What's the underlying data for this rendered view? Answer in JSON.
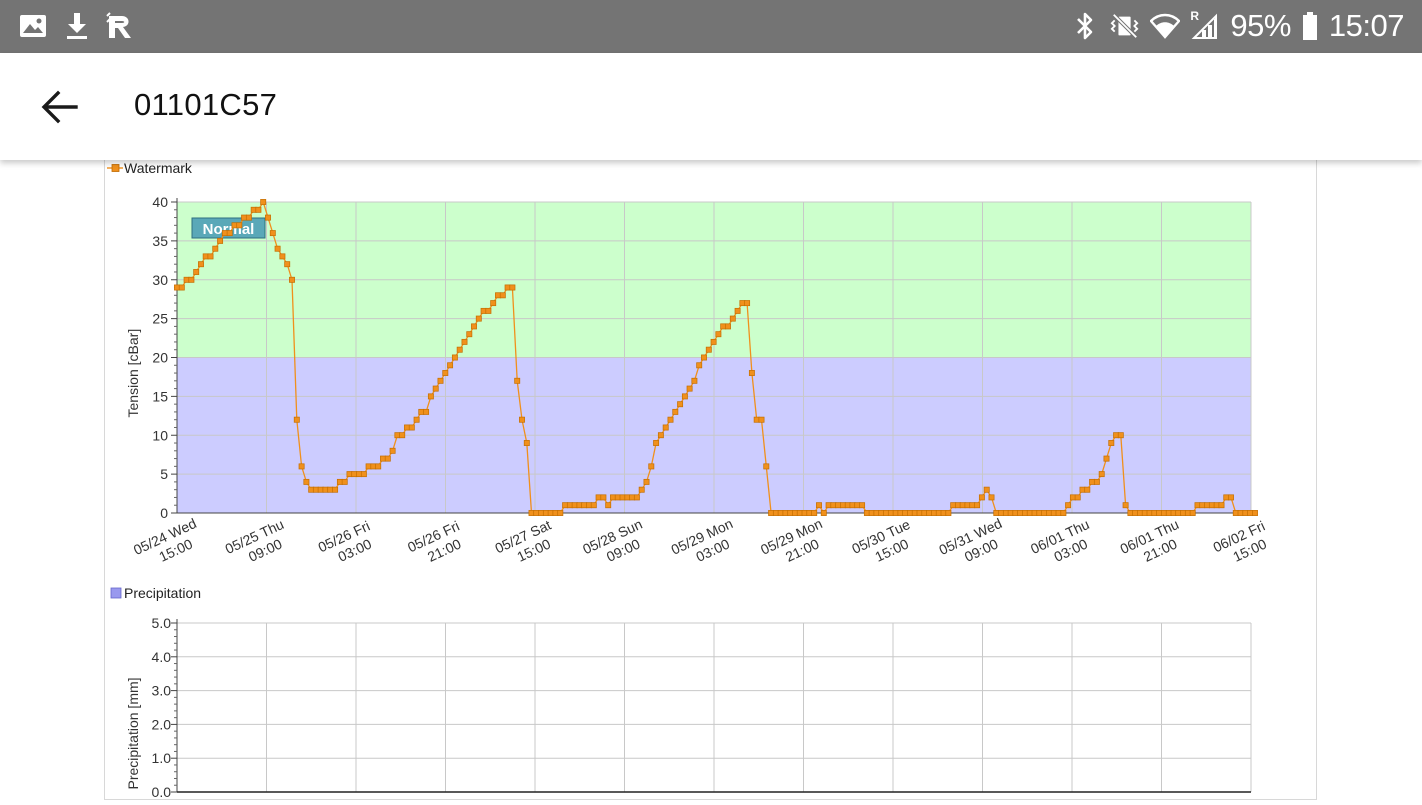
{
  "status_bar": {
    "left_icons": [
      "image-icon",
      "download-icon",
      "app-r-icon"
    ],
    "right_icons": [
      "bluetooth-icon",
      "vibrate-icon",
      "wifi-icon",
      "signal-icon"
    ],
    "signal_badge": "R",
    "battery_percent": "95%",
    "time": "15:07",
    "battery_level": 0.95
  },
  "toolbar": {
    "back_icon": "arrow-back-icon",
    "title": "01101C57"
  },
  "chart_data": [
    {
      "type": "line",
      "title": "",
      "legend": [
        "Watermark"
      ],
      "legend_placement": "top-left",
      "xlabel": "",
      "ylabel": "Tension [cBar]",
      "ylim": [
        0,
        40
      ],
      "y_ticks": [
        0,
        5,
        10,
        15,
        20,
        25,
        30,
        35,
        40
      ],
      "x_unit_hours_start": "05/24 Wed 15:00",
      "x_ticks": [
        {
          "h": 0,
          "l1": "05/24 Wed",
          "l2": "15:00"
        },
        {
          "h": 18,
          "l1": "05/25 Thu",
          "l2": "09:00"
        },
        {
          "h": 36,
          "l1": "05/26 Fri",
          "l2": "03:00"
        },
        {
          "h": 54,
          "l1": "05/26 Fri",
          "l2": "21:00"
        },
        {
          "h": 72,
          "l1": "05/27 Sat",
          "l2": "15:00"
        },
        {
          "h": 90,
          "l1": "05/28 Sun",
          "l2": "09:00"
        },
        {
          "h": 108,
          "l1": "05/29 Mon",
          "l2": "03:00"
        },
        {
          "h": 126,
          "l1": "05/29 Mon",
          "l2": "21:00"
        },
        {
          "h": 144,
          "l1": "05/30 Tue",
          "l2": "15:00"
        },
        {
          "h": 162,
          "l1": "05/31 Wed",
          "l2": "09:00"
        },
        {
          "h": 180,
          "l1": "06/01 Thu",
          "l2": "03:00"
        },
        {
          "h": 198,
          "l1": "06/01 Thu",
          "l2": "21:00"
        },
        {
          "h": 216,
          "l1": "06/02 Fri",
          "l2": "15:00"
        }
      ],
      "xlim_hours": [
        0,
        216
      ],
      "grid": true,
      "bands": [
        {
          "label": "Normal",
          "from": 20,
          "to": 40,
          "color": "#ccffcc"
        },
        {
          "label": "",
          "from": 0,
          "to": 20,
          "color": "#ccccff"
        }
      ],
      "series": [
        {
          "name": "Watermark",
          "color": "#f0901c",
          "points": [
            [
              0,
              29
            ],
            [
              1,
              29
            ],
            [
              2,
              30
            ],
            [
              3,
              30
            ],
            [
              4,
              31
            ],
            [
              5,
              32
            ],
            [
              6,
              33
            ],
            [
              7,
              33
            ],
            [
              8,
              34
            ],
            [
              9,
              35
            ],
            [
              10,
              36
            ],
            [
              11,
              36
            ],
            [
              12,
              37
            ],
            [
              13,
              37
            ],
            [
              14,
              38
            ],
            [
              15,
              38
            ],
            [
              16,
              39
            ],
            [
              17,
              39
            ],
            [
              18,
              40
            ],
            [
              19,
              38
            ],
            [
              20,
              36
            ],
            [
              21,
              34
            ],
            [
              22,
              33
            ],
            [
              23,
              32
            ],
            [
              24,
              30
            ],
            [
              25,
              12
            ],
            [
              26,
              6
            ],
            [
              27,
              4
            ],
            [
              28,
              3
            ],
            [
              29,
              3
            ],
            [
              30,
              3
            ],
            [
              31,
              3
            ],
            [
              32,
              3
            ],
            [
              33,
              3
            ],
            [
              34,
              4
            ],
            [
              35,
              4
            ],
            [
              36,
              5
            ],
            [
              37,
              5
            ],
            [
              38,
              5
            ],
            [
              39,
              5
            ],
            [
              40,
              6
            ],
            [
              41,
              6
            ],
            [
              42,
              6
            ],
            [
              43,
              7
            ],
            [
              44,
              7
            ],
            [
              45,
              8
            ],
            [
              46,
              10
            ],
            [
              47,
              10
            ],
            [
              48,
              11
            ],
            [
              49,
              11
            ],
            [
              50,
              12
            ],
            [
              51,
              13
            ],
            [
              52,
              13
            ],
            [
              53,
              15
            ],
            [
              54,
              16
            ],
            [
              55,
              17
            ],
            [
              56,
              18
            ],
            [
              57,
              19
            ],
            [
              58,
              20
            ],
            [
              59,
              21
            ],
            [
              60,
              22
            ],
            [
              61,
              23
            ],
            [
              62,
              24
            ],
            [
              63,
              25
            ],
            [
              64,
              26
            ],
            [
              65,
              26
            ],
            [
              66,
              27
            ],
            [
              67,
              28
            ],
            [
              68,
              28
            ],
            [
              69,
              29
            ],
            [
              70,
              29
            ],
            [
              71,
              17
            ],
            [
              72,
              12
            ],
            [
              73,
              9
            ],
            [
              74,
              0
            ],
            [
              75,
              0
            ],
            [
              76,
              0
            ],
            [
              77,
              0
            ],
            [
              78,
              0
            ],
            [
              79,
              0
            ],
            [
              80,
              0
            ],
            [
              81,
              1
            ],
            [
              82,
              1
            ],
            [
              83,
              1
            ],
            [
              84,
              1
            ],
            [
              85,
              1
            ],
            [
              86,
              1
            ],
            [
              87,
              1
            ],
            [
              88,
              2
            ],
            [
              89,
              2
            ],
            [
              90,
              1
            ],
            [
              91,
              2
            ],
            [
              92,
              2
            ],
            [
              93,
              2
            ],
            [
              94,
              2
            ],
            [
              95,
              2
            ],
            [
              96,
              2
            ],
            [
              97,
              3
            ],
            [
              98,
              4
            ],
            [
              99,
              6
            ],
            [
              100,
              9
            ],
            [
              101,
              10
            ],
            [
              102,
              11
            ],
            [
              103,
              12
            ],
            [
              104,
              13
            ],
            [
              105,
              14
            ],
            [
              106,
              15
            ],
            [
              107,
              16
            ],
            [
              108,
              17
            ],
            [
              109,
              19
            ],
            [
              110,
              20
            ],
            [
              111,
              21
            ],
            [
              112,
              22
            ],
            [
              113,
              23
            ],
            [
              114,
              24
            ],
            [
              115,
              24
            ],
            [
              116,
              25
            ],
            [
              117,
              26
            ],
            [
              118,
              27
            ],
            [
              119,
              27
            ],
            [
              120,
              18
            ],
            [
              121,
              12
            ],
            [
              122,
              12
            ],
            [
              123,
              6
            ],
            [
              124,
              0
            ],
            [
              125,
              0
            ],
            [
              126,
              0
            ],
            [
              127,
              0
            ],
            [
              128,
              0
            ],
            [
              129,
              0
            ],
            [
              130,
              0
            ],
            [
              131,
              0
            ],
            [
              132,
              0
            ],
            [
              133,
              0
            ],
            [
              134,
              1
            ],
            [
              135,
              0
            ],
            [
              136,
              1
            ],
            [
              137,
              1
            ],
            [
              138,
              1
            ],
            [
              139,
              1
            ],
            [
              140,
              1
            ],
            [
              141,
              1
            ],
            [
              142,
              1
            ],
            [
              143,
              1
            ],
            [
              144,
              0
            ],
            [
              145,
              0
            ],
            [
              146,
              0
            ],
            [
              147,
              0
            ],
            [
              148,
              0
            ],
            [
              149,
              0
            ],
            [
              150,
              0
            ],
            [
              151,
              0
            ],
            [
              152,
              0
            ],
            [
              153,
              0
            ],
            [
              154,
              0
            ],
            [
              155,
              0
            ],
            [
              156,
              0
            ],
            [
              157,
              0
            ],
            [
              158,
              0
            ],
            [
              159,
              0
            ],
            [
              160,
              0
            ],
            [
              161,
              0
            ],
            [
              162,
              1
            ],
            [
              163,
              1
            ],
            [
              164,
              1
            ],
            [
              165,
              1
            ],
            [
              166,
              1
            ],
            [
              167,
              1
            ],
            [
              168,
              2
            ],
            [
              169,
              3
            ],
            [
              170,
              2
            ],
            [
              171,
              0
            ],
            [
              172,
              0
            ],
            [
              173,
              0
            ],
            [
              174,
              0
            ],
            [
              175,
              0
            ],
            [
              176,
              0
            ],
            [
              177,
              0
            ],
            [
              178,
              0
            ],
            [
              179,
              0
            ],
            [
              180,
              0
            ],
            [
              181,
              0
            ],
            [
              182,
              0
            ],
            [
              183,
              0
            ],
            [
              184,
              0
            ],
            [
              185,
              0
            ],
            [
              186,
              1
            ],
            [
              187,
              2
            ],
            [
              188,
              2
            ],
            [
              189,
              3
            ],
            [
              190,
              3
            ],
            [
              191,
              4
            ],
            [
              192,
              4
            ],
            [
              193,
              5
            ],
            [
              194,
              7
            ],
            [
              195,
              9
            ],
            [
              196,
              10
            ],
            [
              197,
              10
            ],
            [
              198,
              1
            ],
            [
              199,
              0
            ],
            [
              200,
              0
            ],
            [
              201,
              0
            ],
            [
              202,
              0
            ],
            [
              203,
              0
            ],
            [
              204,
              0
            ],
            [
              205,
              0
            ],
            [
              206,
              0
            ],
            [
              207,
              0
            ],
            [
              208,
              0
            ],
            [
              209,
              0
            ],
            [
              210,
              0
            ],
            [
              211,
              0
            ],
            [
              212,
              0
            ],
            [
              213,
              1
            ],
            [
              214,
              1
            ],
            [
              215,
              1
            ],
            [
              216,
              1
            ],
            [
              217,
              1
            ],
            [
              218,
              1
            ],
            [
              219,
              2
            ],
            [
              220,
              2
            ],
            [
              221,
              0
            ],
            [
              222,
              0
            ],
            [
              223,
              0
            ],
            [
              224,
              0
            ],
            [
              225,
              0
            ]
          ]
        }
      ]
    },
    {
      "type": "bar",
      "title": "",
      "legend": [
        "Precipitation"
      ],
      "legend_placement": "top-left",
      "legend_color": "#9999ee",
      "xlabel": "",
      "ylabel": "Precipitation [mm]",
      "ylim": [
        0,
        5
      ],
      "y_ticks": [
        "0.0",
        "1.0",
        "2.0",
        "3.0",
        "4.0",
        "5.0"
      ],
      "xlim_hours": [
        0,
        216
      ],
      "grid": true,
      "series": [
        {
          "name": "Precipitation",
          "values": []
        }
      ]
    }
  ]
}
